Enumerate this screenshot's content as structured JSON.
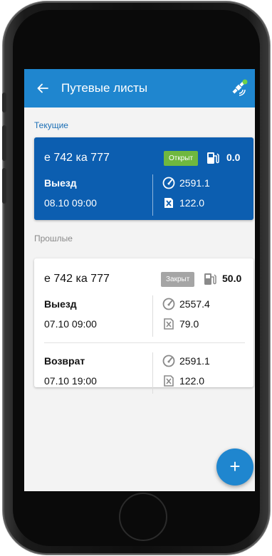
{
  "appbar": {
    "title": "Путевые листы"
  },
  "sections": {
    "current": "Текущие",
    "past": "Прошлые"
  },
  "colors": {
    "primary": "#1f86cf",
    "card_current": "#0c5eb0",
    "badge_open": "#6fb83f",
    "badge_closed": "#a5a5a5"
  },
  "icons": {
    "back": "arrow-left-icon",
    "status": "satellite-icon",
    "fuel": "fuel-pump-icon",
    "odometer": "speedometer-icon",
    "tank": "fuel-can-icon",
    "add": "plus-icon"
  },
  "current_card": {
    "plate": "е 742 ка 777",
    "status": "Открыт",
    "fuel": "0.0",
    "departure": {
      "label": "Выезд",
      "time": "08.10 09:00",
      "odometer": "2591.1",
      "fuel": "122.0"
    }
  },
  "past_card": {
    "plate": "е 742 ка 777",
    "status": "Закрыт",
    "fuel": "50.0",
    "departure": {
      "label": "Выезд",
      "time": "07.10 09:00",
      "odometer": "2557.4",
      "fuel": "79.0"
    },
    "return": {
      "label": "Возврат",
      "time": "07.10 19:00",
      "odometer": "2591.1",
      "fuel": "122.0"
    }
  },
  "fab": {
    "label": "+"
  }
}
